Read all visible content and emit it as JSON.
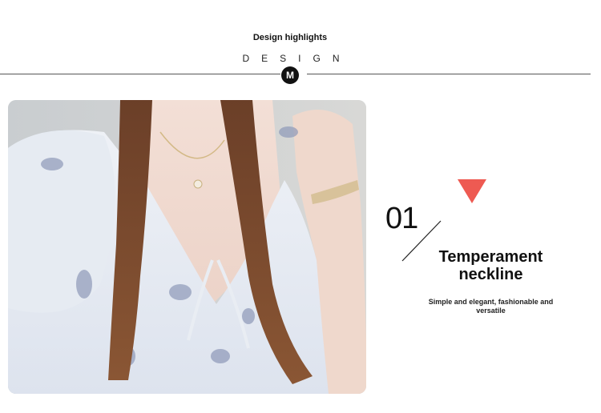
{
  "header": {
    "title": "Design highlights",
    "design_word": "DESIGN",
    "badge_letter": "M"
  },
  "feature": {
    "number": "01",
    "title_line1": "Temperament",
    "title_line2": "neckline",
    "description": "Simple and elegant, fashionable and versatile",
    "accent_color": "#ee5a52",
    "marker_icon": "down-triangle-icon"
  },
  "photo": {
    "subject": "product-photo-blouse-neckline"
  }
}
